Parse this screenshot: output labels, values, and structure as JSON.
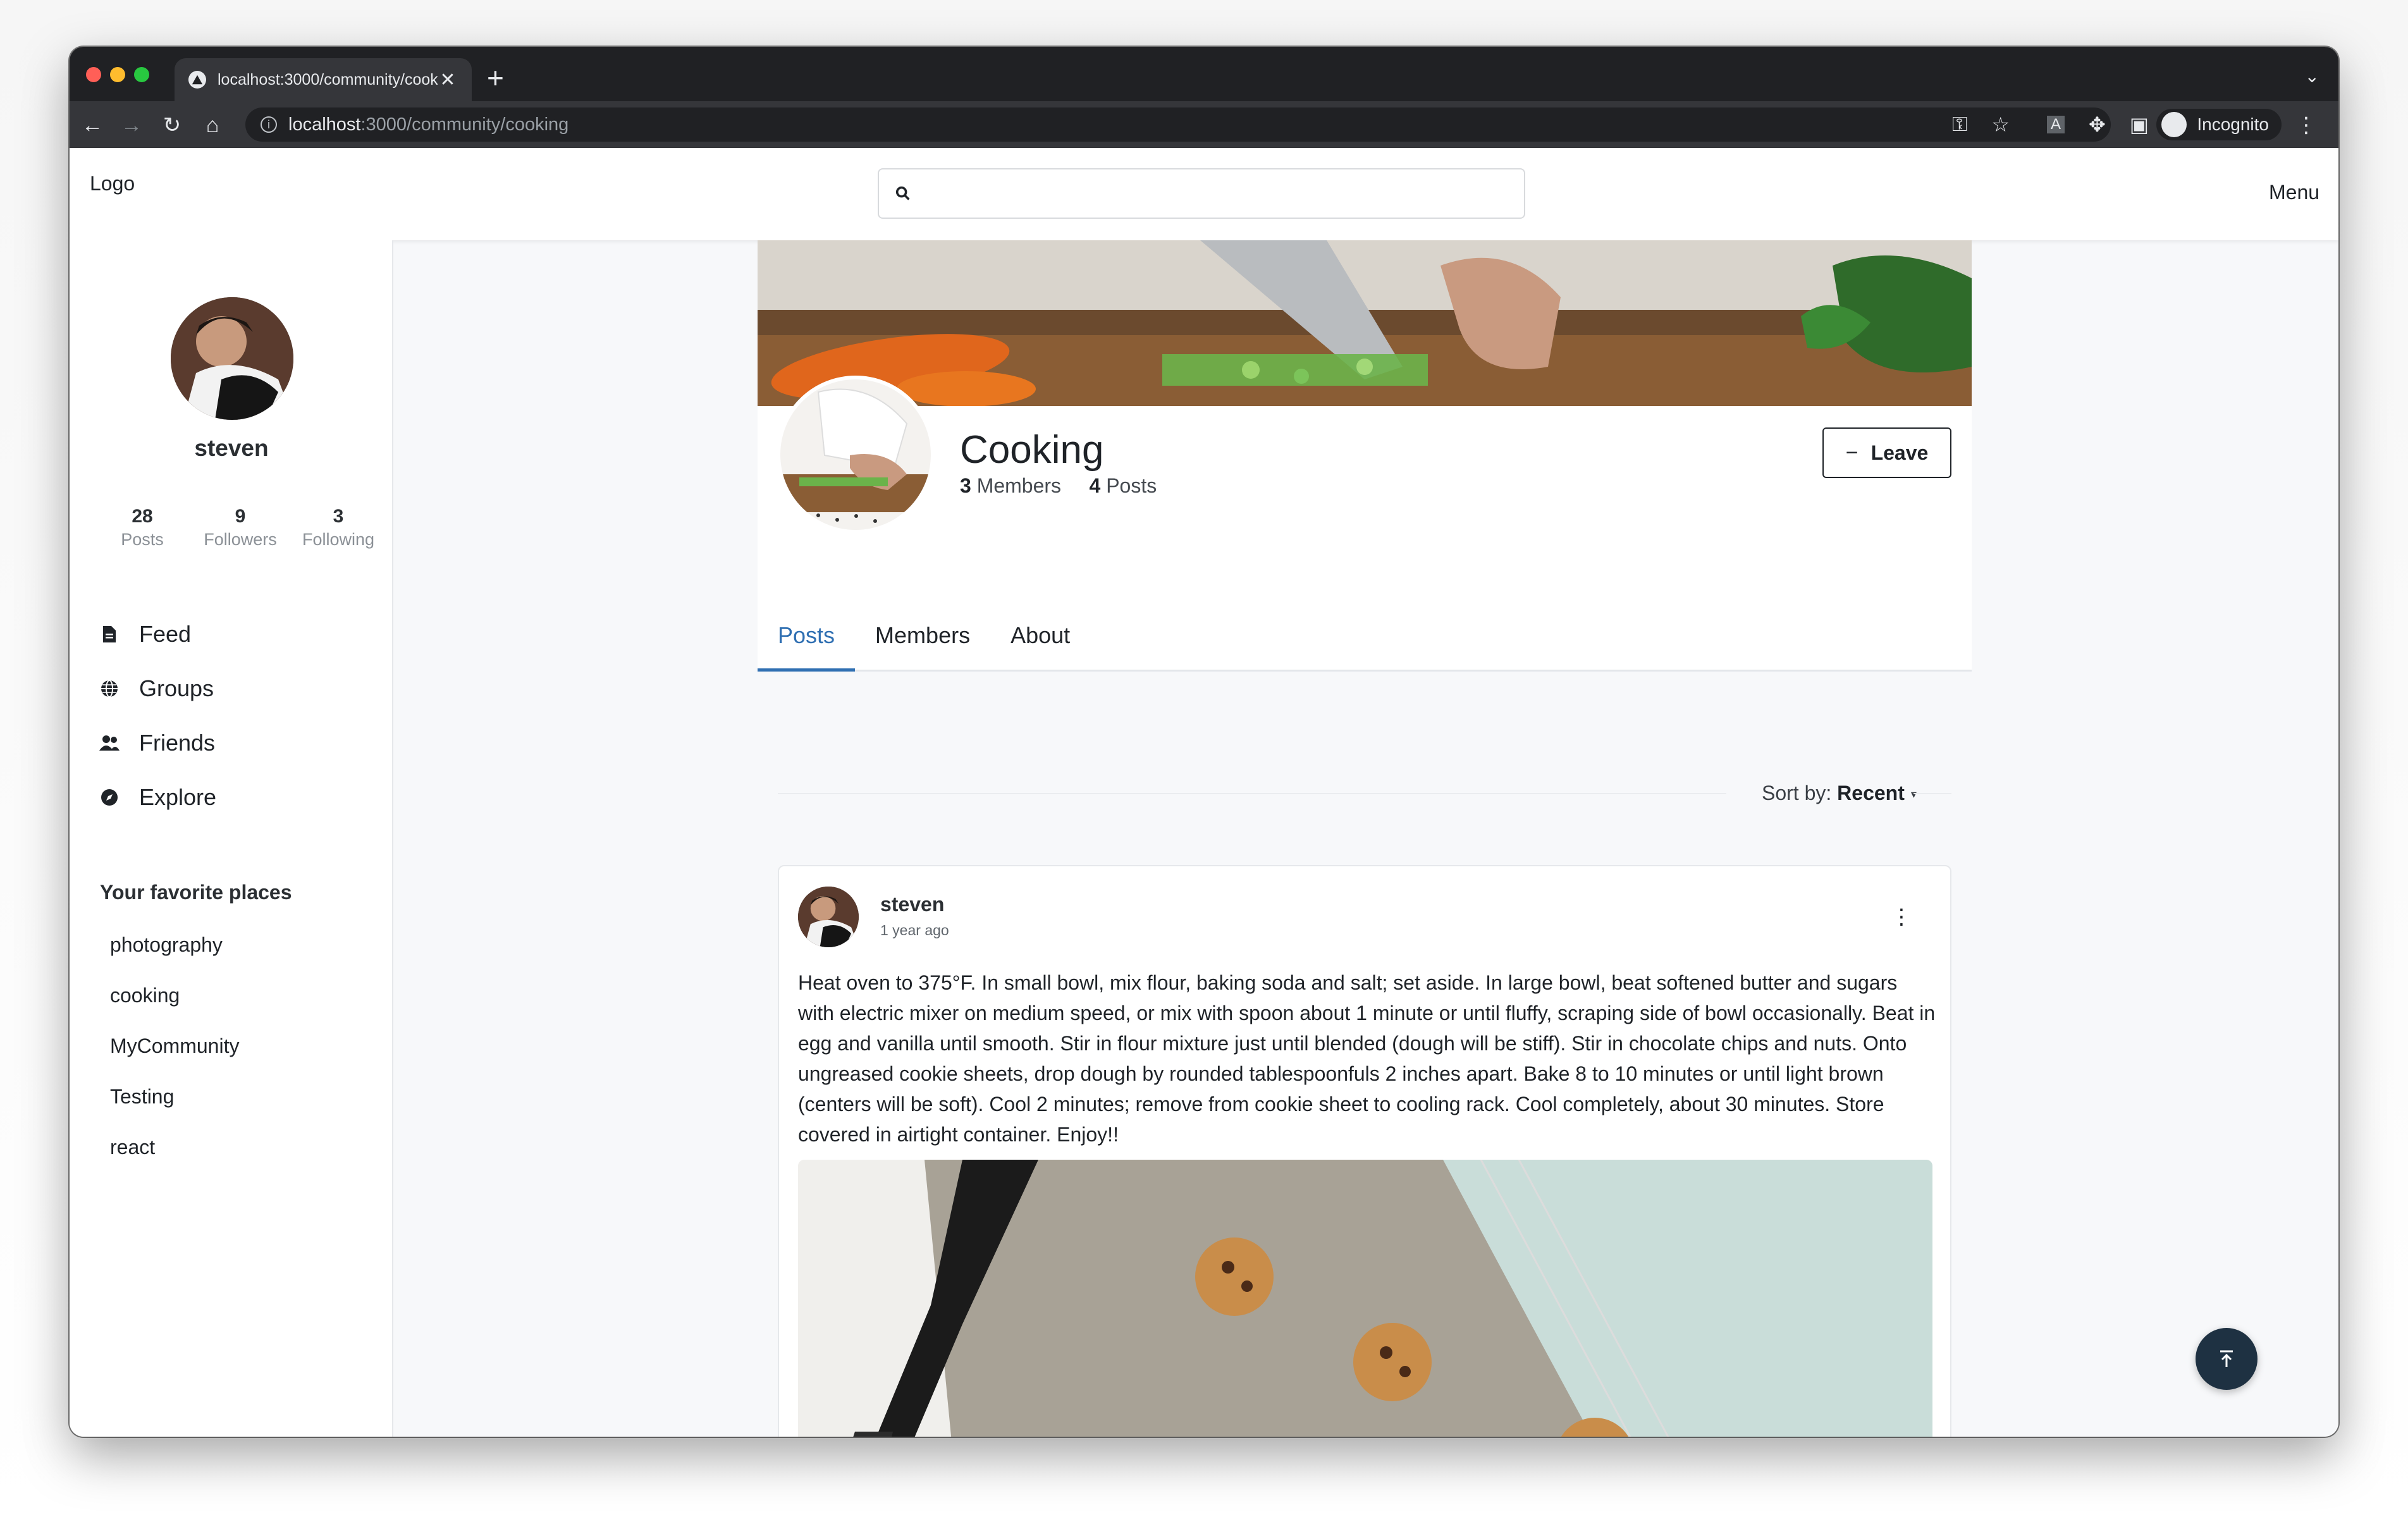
{
  "browser": {
    "tab_title": "localhost:3000/community/cooking",
    "tab_close": "✕",
    "new_tab": "+",
    "url_host": "localhost",
    "url_path": ":3000/community/cooking",
    "incognito_label": "Incognito"
  },
  "header": {
    "logo": "Logo",
    "search_placeholder": "",
    "menu": "Menu"
  },
  "profile": {
    "name": "steven",
    "stats": [
      {
        "num": "28",
        "label": "Posts"
      },
      {
        "num": "9",
        "label": "Followers"
      },
      {
        "num": "3",
        "label": "Following"
      }
    ]
  },
  "nav": [
    {
      "label": "Feed",
      "icon": "document-icon"
    },
    {
      "label": "Groups",
      "icon": "globe-icon"
    },
    {
      "label": "Friends",
      "icon": "users-icon"
    },
    {
      "label": "Explore",
      "icon": "compass-icon"
    }
  ],
  "favorites": {
    "title": "Your favorite places",
    "items": [
      "photography",
      "cooking",
      "MyCommunity",
      "Testing",
      "react"
    ]
  },
  "community": {
    "name": "Cooking",
    "members_count": "3",
    "members_label": "Members",
    "posts_count": "4",
    "posts_label": "Posts",
    "leave_label": "Leave",
    "tabs": [
      "Posts",
      "Members",
      "About"
    ],
    "active_tab": "Posts"
  },
  "sort": {
    "label": "Sort by:",
    "value": "Recent"
  },
  "post": {
    "author": "steven",
    "time": "1 year ago",
    "body": "Heat oven to 375°F. In small bowl, mix flour, baking soda and salt; set aside. In large bowl, beat softened butter and sugars with electric mixer on medium speed, or mix with spoon about 1 minute or until fluffy, scraping side of bowl occasionally. Beat in egg and vanilla until smooth. Stir in flour mixture just until blended (dough will be stiff). Stir in chocolate chips and nuts. Onto ungreased cookie sheets, drop dough by rounded tablespoonfuls 2 inches apart. Bake 8 to 10 minutes or until light brown (centers will be soft). Cool 2 minutes; remove from cookie sheet to cooling rack. Cool completely, about 30 minutes. Store covered in airtight container. Enjoy!!"
  },
  "colors": {
    "accent": "#2f6fb2",
    "fab": "#1e3142"
  }
}
